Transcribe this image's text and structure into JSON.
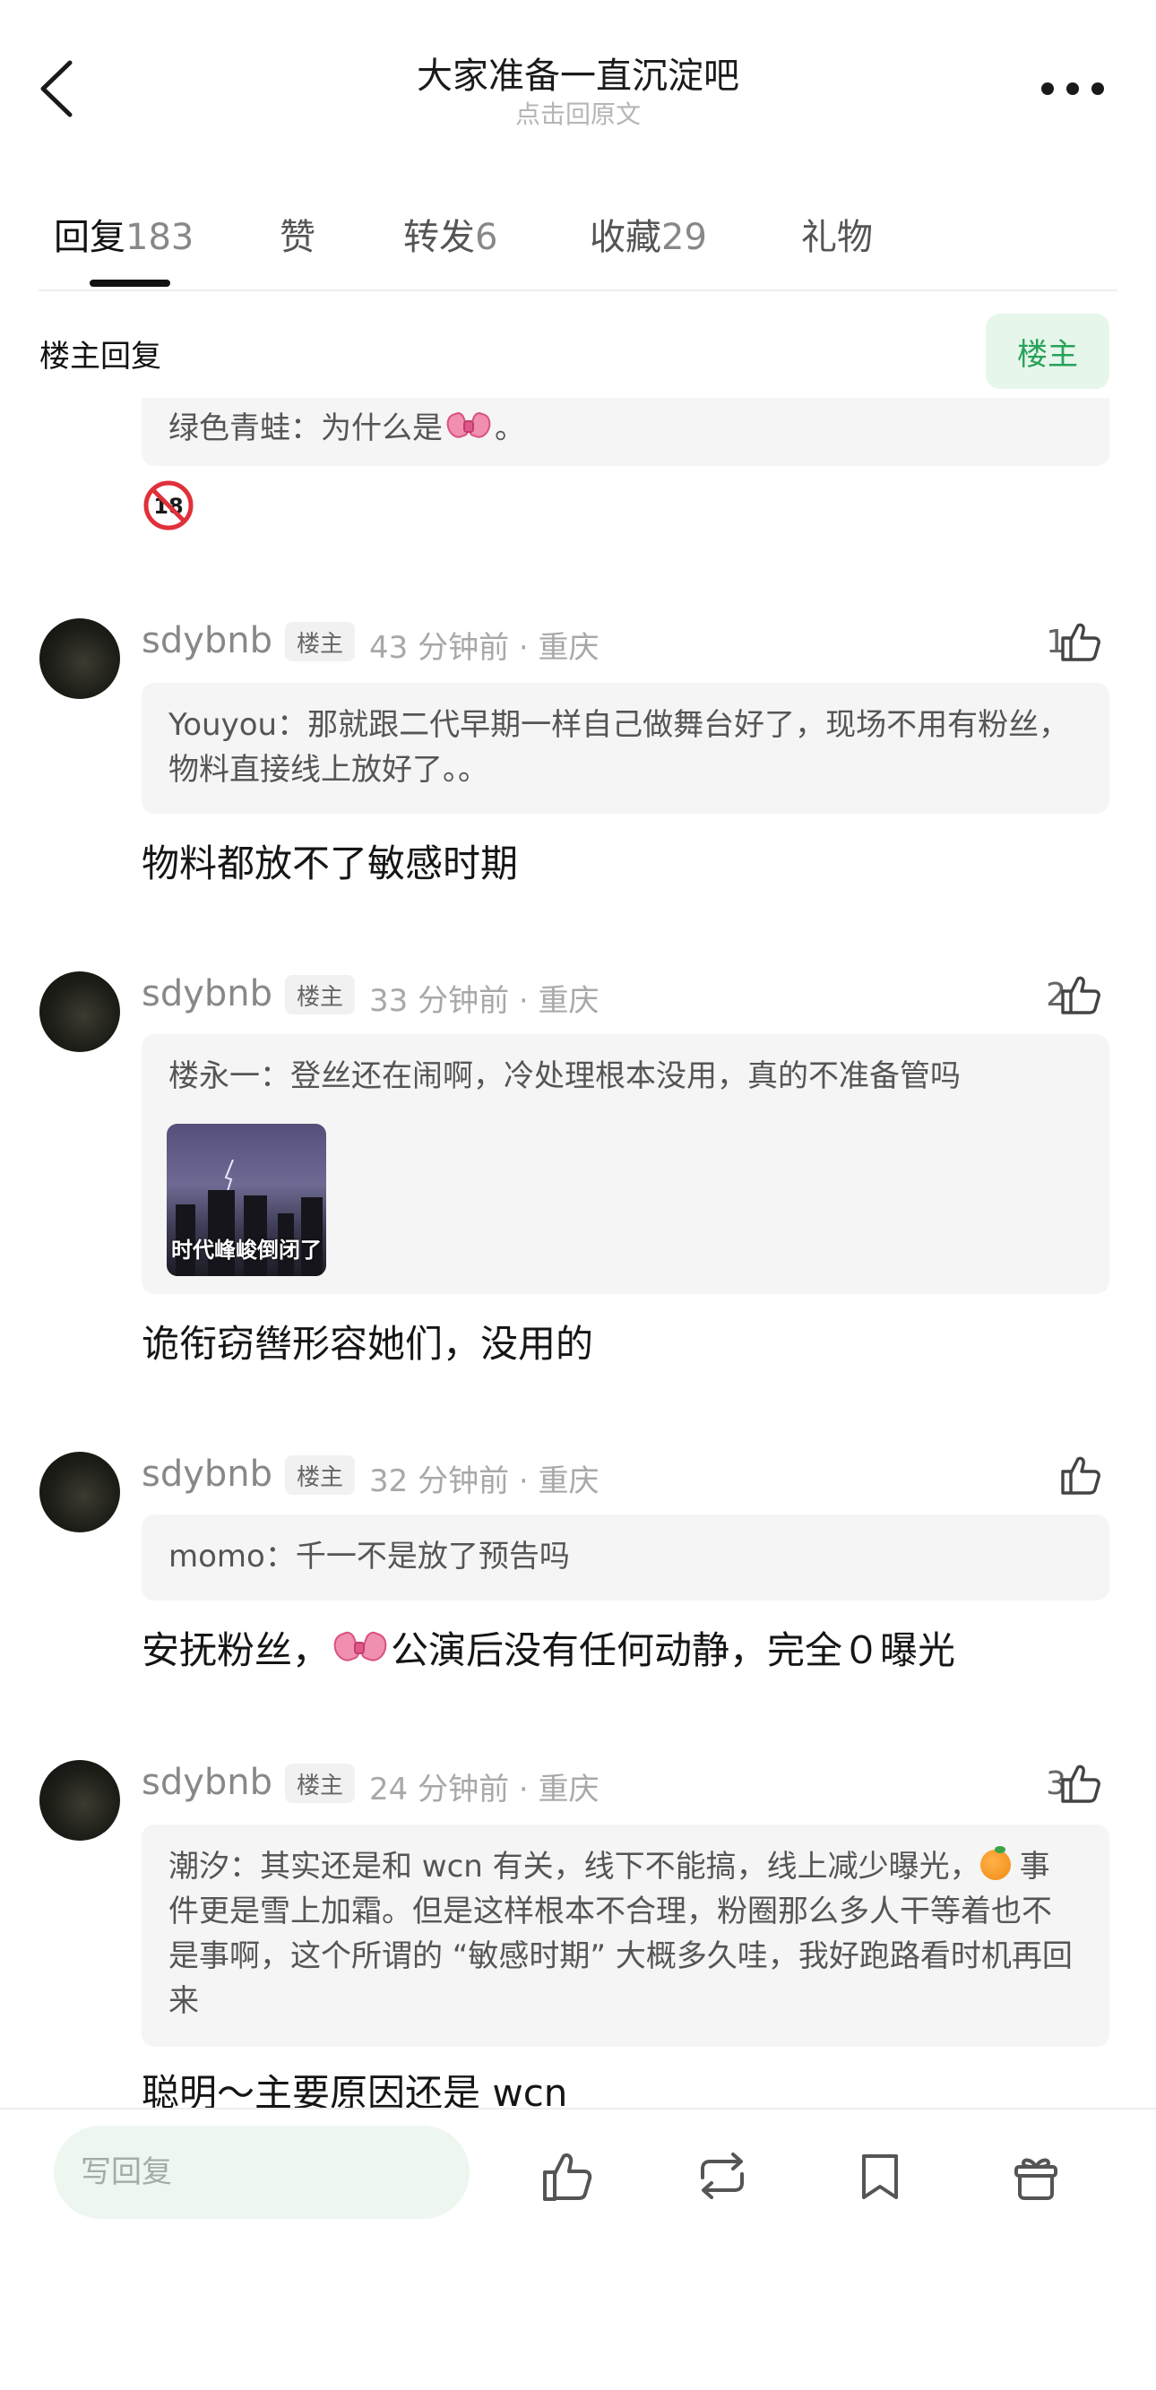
{
  "header": {
    "title": "大家准备一直沉淀吧",
    "subtitle": "点击回原文"
  },
  "tabs": [
    {
      "label": "回复",
      "count": "183",
      "active": true
    },
    {
      "label": "赞",
      "count": ""
    },
    {
      "label": "转发",
      "count": "6"
    },
    {
      "label": "收藏",
      "count": "29"
    },
    {
      "label": "礼物",
      "count": ""
    }
  ],
  "section": {
    "label": "楼主回复",
    "owner_button": "楼主"
  },
  "partial_comment": {
    "quote_prefix": "绿色青蛙：为什么是",
    "quote_suffix": "。",
    "emoji": "🔞"
  },
  "comments": [
    {
      "user": "sdybnb",
      "badge": "楼主",
      "time_location": "43 分钟前 · 重庆",
      "likes": "1",
      "quote": "Youyou：那就跟二代早期一样自己做舞台好了，现场不用有粉丝，物料直接线上放好了。。",
      "body": "物料都放不了敏感时期"
    },
    {
      "user": "sdybnb",
      "badge": "楼主",
      "time_location": "33 分钟前 · 重庆",
      "likes": "2",
      "quote": "楼永一：登丝还在闹啊，冷处理根本没用，真的不准备管吗",
      "image_caption": "时代峰峻倒闭了",
      "body": "诡衔窃辔形容她们，没用的"
    },
    {
      "user": "sdybnb",
      "badge": "楼主",
      "time_location": "32 分钟前 · 重庆",
      "likes": "",
      "quote": "momo：千一不是放了预告吗",
      "body_prefix": "安抚粉丝，",
      "body_suffix": "公演后没有任何动静，完全０曝光"
    },
    {
      "user": "sdybnb",
      "badge": "楼主",
      "time_location": "24 分钟前 · 重庆",
      "likes": "3",
      "quote_prefix": "潮汐：其实还是和 wcn 有关，线下不能搞，线上减少曝光，",
      "quote_suffix": "事件更是雪上加霜。但是这样根本不合理，粉圈那么多人干等着也不是事啊，这个所谓的 “敏感时期” 大概多久哇，我好跑路看时机再回来",
      "body": "聪明～主要原因还是 wcn"
    }
  ],
  "bottom_bar": {
    "reply_placeholder": "写回复",
    "icons": [
      "like-icon",
      "repost-icon",
      "bookmark-icon",
      "gift-icon"
    ]
  },
  "colors": {
    "accent_green": "#27a25a",
    "owner_button_bg": "#e6f6ea",
    "quote_bg": "#f5f5f5",
    "reply_input_bg": "#eef6f0"
  }
}
